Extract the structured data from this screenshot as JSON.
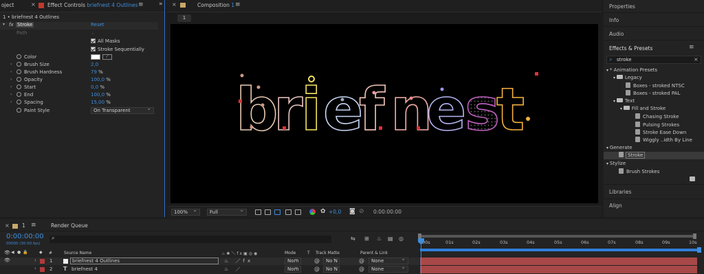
{
  "effect_controls": {
    "tab_project": "oject",
    "tab_prefix": "Effect Controls",
    "tab_layer": "briefnest 4 Outlines",
    "breadcrumb": "1 • briefnest 4 Outlines",
    "effect_name": "Stroke",
    "reset_label": "Reset",
    "path_label": "Path",
    "all_masks_label": "All Masks",
    "stroke_sequentially_label": "Stroke Sequentially",
    "properties": [
      {
        "label": "Color",
        "value": ""
      },
      {
        "label": "Brush Size",
        "value": "2,0"
      },
      {
        "label": "Brush Hardness",
        "value": "79",
        "unit": "%"
      },
      {
        "label": "Opacity",
        "value": "100,0",
        "unit": "%"
      },
      {
        "label": "Start",
        "value": "0,0",
        "unit": "%"
      },
      {
        "label": "End",
        "value": "100,0",
        "unit": "%"
      },
      {
        "label": "Spacing",
        "value": "15,00",
        "unit": "%"
      },
      {
        "label": "Paint Style",
        "value": ""
      }
    ],
    "paint_style_value": "On Transparent"
  },
  "composition": {
    "tab_prefix": "Composition",
    "tab_number": "1",
    "comp_tab_chip": "1",
    "canvas_text": "briefnest",
    "zoom": "100%",
    "resolution": "Full",
    "exposure": "+0,0",
    "timecode": "0:00:00:00"
  },
  "right_panel": {
    "properties": "Properties",
    "info": "Info",
    "audio": "Audio",
    "effects_presets": "Effects & Presets",
    "search_value": "stroke",
    "tree": [
      {
        "label": "* Animation Presets",
        "level": 0,
        "kind": "group"
      },
      {
        "label": "Legacy",
        "level": 1,
        "kind": "folder"
      },
      {
        "label": "Boxes - stroked NTSC",
        "level": 2,
        "kind": "preset"
      },
      {
        "label": "Boxes - stroked PAL",
        "level": 2,
        "kind": "preset"
      },
      {
        "label": "Text",
        "level": 1,
        "kind": "folder"
      },
      {
        "label": "Fill and Stroke",
        "level": 2,
        "kind": "folder"
      },
      {
        "label": "Chasing Stroke",
        "level": 3,
        "kind": "preset"
      },
      {
        "label": "Pulsing Strokes",
        "level": 3,
        "kind": "preset"
      },
      {
        "label": "Stroke Ease Down",
        "level": 3,
        "kind": "preset"
      },
      {
        "label": "Wiggly ..idth By Line",
        "level": 3,
        "kind": "preset"
      },
      {
        "label": "Generate",
        "level": 0,
        "kind": "group"
      },
      {
        "label": "Stroke",
        "level": 1,
        "kind": "effect",
        "selected": true
      },
      {
        "label": "Stylize",
        "level": 0,
        "kind": "group"
      },
      {
        "label": "Brush Strokes",
        "level": 1,
        "kind": "effect"
      }
    ],
    "libraries": "Libraries",
    "align": "Align"
  },
  "timeline": {
    "tab_number": "1",
    "render_queue": "Render Queue",
    "current_time": "0:00:00:00",
    "fps_label": "00000 (30.00 fps)",
    "columns": {
      "hash": "#",
      "source_name": "Source Name",
      "mode": "Mode",
      "t": "T",
      "track_matte": "Track Matte",
      "parent_link": "Parent & Link"
    },
    "ruler": [
      "00s",
      "01s",
      "02s",
      "03s",
      "04s",
      "05s",
      "06s",
      "07s",
      "08s",
      "09s",
      "10s"
    ],
    "layers": [
      {
        "num": "1",
        "name": "briefnest 4 Outlines",
        "mode": "Norn",
        "matte": "No N",
        "parent": "None",
        "label_color": "#b23a3a",
        "type_icon": "box"
      },
      {
        "num": "2",
        "name": "briefnest 4",
        "mode": "Norn",
        "matte": "No N",
        "parent": "None",
        "label_color": "#b23a3a",
        "type_icon": "T"
      }
    ]
  },
  "colors": {
    "accent_blue": "#3f8ddc",
    "track_red": "#a84848",
    "work_area": "#2f7ed8",
    "canvas_bg": "#000000"
  }
}
